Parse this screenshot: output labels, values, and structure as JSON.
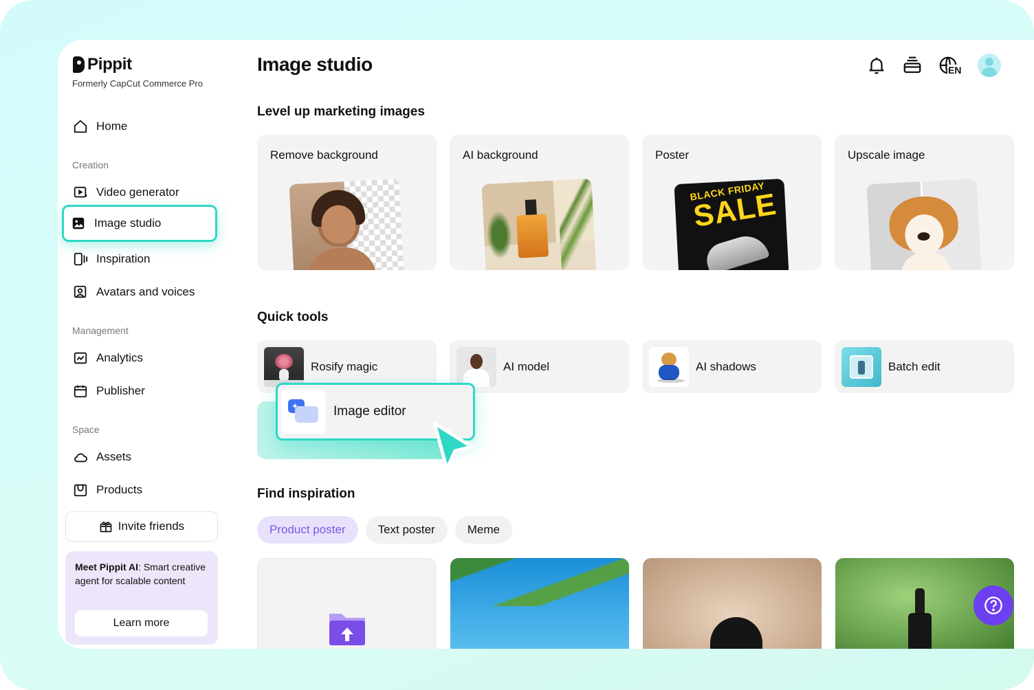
{
  "brand": {
    "name": "Pippit",
    "tagline": "Formerly CapCut Commerce Pro"
  },
  "nav": {
    "home": "Home",
    "creation_label": "Creation",
    "video_generator": "Video generator",
    "image_studio": "Image studio",
    "inspiration": "Inspiration",
    "avatars": "Avatars and voices",
    "management_label": "Management",
    "analytics": "Analytics",
    "publisher": "Publisher",
    "space_label": "Space",
    "assets": "Assets",
    "products": "Products",
    "invite": "Invite friends"
  },
  "promo": {
    "bold": "Meet Pippit AI",
    "rest": ": Smart creative agent for scalable content",
    "button": "Learn more"
  },
  "header": {
    "title": "Image studio",
    "lang": "EN"
  },
  "marketing": {
    "heading": "Level up marketing images",
    "cards": [
      "Remove background",
      "AI background",
      "Poster",
      "Upscale image"
    ],
    "poster_line1": "BLACK FRIDAY",
    "poster_line2": "SALE"
  },
  "quick_tools": {
    "heading": "Quick tools",
    "items": [
      "Rosify magic",
      "AI model",
      "AI shadows",
      "Batch edit"
    ],
    "highlight": "Image editor"
  },
  "inspiration": {
    "heading": "Find inspiration",
    "chips": [
      "Product poster",
      "Text poster",
      "Meme"
    ],
    "active_chip": 0
  },
  "colors": {
    "accent": "#2ed8c4",
    "purple": "#6c3ff0",
    "chip_active_text": "#7a57e6"
  }
}
